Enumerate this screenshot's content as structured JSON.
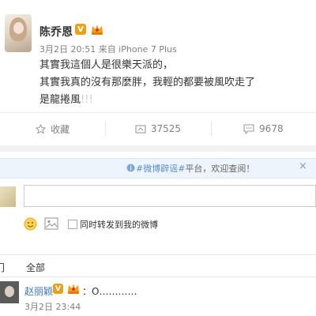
{
  "post": {
    "author": "陈乔恩",
    "meta": "3月2日 20:51 来自 iPhone 7 Plus",
    "lines": [
      "其實我這個人是很樂天派的，",
      "其實我真的沒有那麼胖，我輕的都要被風吹走了"
    ],
    "last_line_main": "是龍捲風",
    "last_line_tail": "!!!"
  },
  "actions": {
    "favorite_label": "收藏",
    "repost_count": "37525",
    "comment_count": "9678"
  },
  "hint": {
    "topic": "#微博辟谣#",
    "rest": "平台，欢迎查阅！"
  },
  "composer": {
    "repost_label": "同时转发到我的微博"
  },
  "filters": {
    "hot": "门",
    "all": "全部"
  },
  "comment": {
    "author": "赵丽颖",
    "text": "：O…………",
    "time": "3月2日 23:44"
  },
  "colors": {
    "link": "#3c78b4",
    "badge": "#e8a21a",
    "hint_bg": "#eef4fb",
    "muted": "#808080"
  }
}
